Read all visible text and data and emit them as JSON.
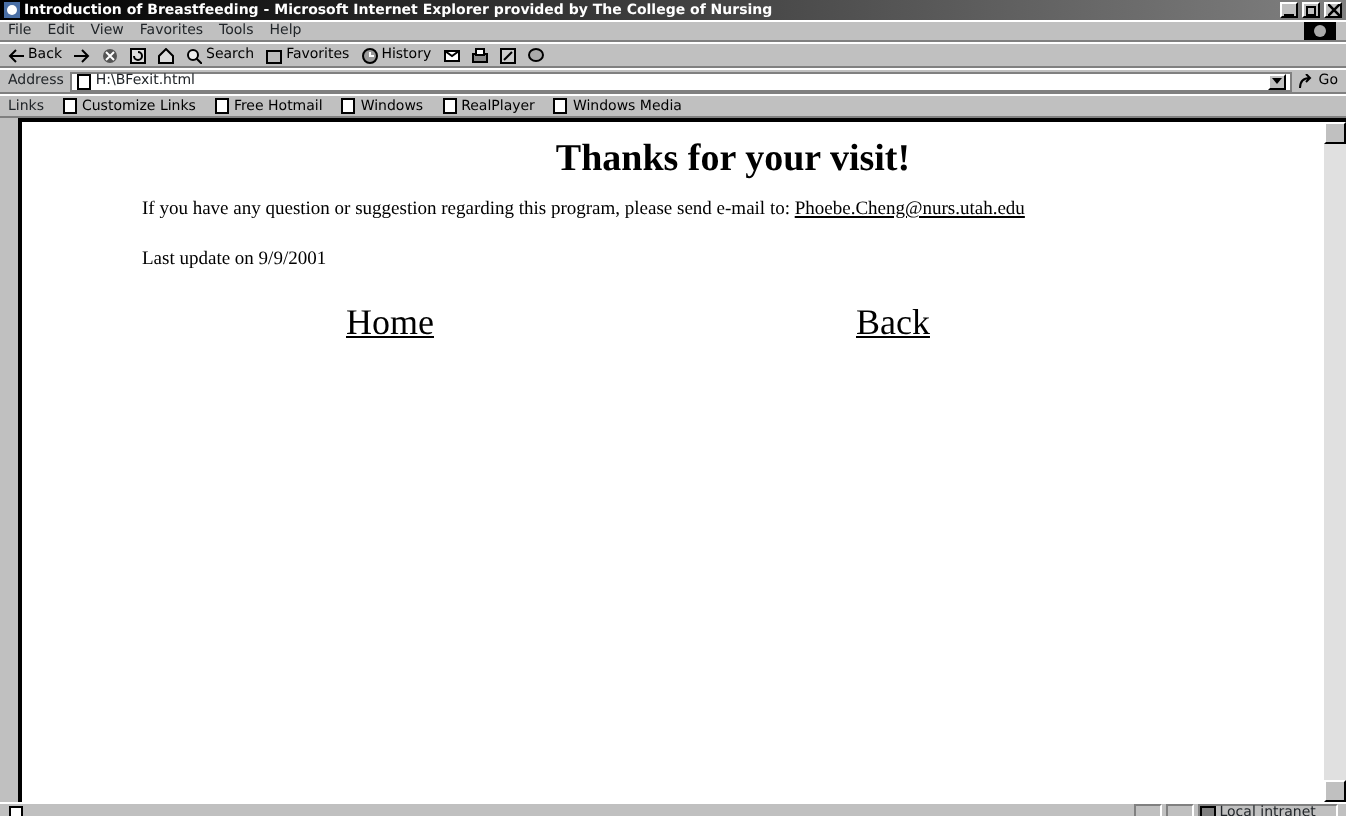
{
  "window": {
    "title": "Introduction of Breastfeeding - Microsoft Internet Explorer provided by The College of Nursing"
  },
  "menu": [
    "File",
    "Edit",
    "View",
    "Favorites",
    "Tools",
    "Help"
  ],
  "toolbar": [
    {
      "kind": "back",
      "label": "Back"
    },
    {
      "kind": "forward"
    },
    {
      "kind": "stop"
    },
    {
      "kind": "refresh"
    },
    {
      "kind": "home"
    },
    {
      "kind": "search",
      "label": "Search"
    },
    {
      "kind": "favorites",
      "label": "Favorites"
    },
    {
      "kind": "history",
      "label": "History"
    },
    {
      "kind": "mail"
    },
    {
      "kind": "print"
    },
    {
      "kind": "edit"
    },
    {
      "kind": "discuss"
    }
  ],
  "address": {
    "label": "Address",
    "value": "H:\\BFexit.html",
    "go": "Go"
  },
  "links": {
    "label": "Links",
    "items": [
      "Customize Links",
      "Free Hotmail",
      "Windows",
      "RealPlayer",
      "Windows Media"
    ]
  },
  "page": {
    "heading": "Thanks for your visit!",
    "message": "If you have any question or suggestion regarding this program, please send e-mail to:",
    "email": "Phoebe.Cheng@nurs.utah.edu",
    "updated": "Last update on 9/9/2001",
    "nav": [
      "Home",
      "Back"
    ]
  },
  "status_bar": {
    "zone": "Local intranet"
  }
}
